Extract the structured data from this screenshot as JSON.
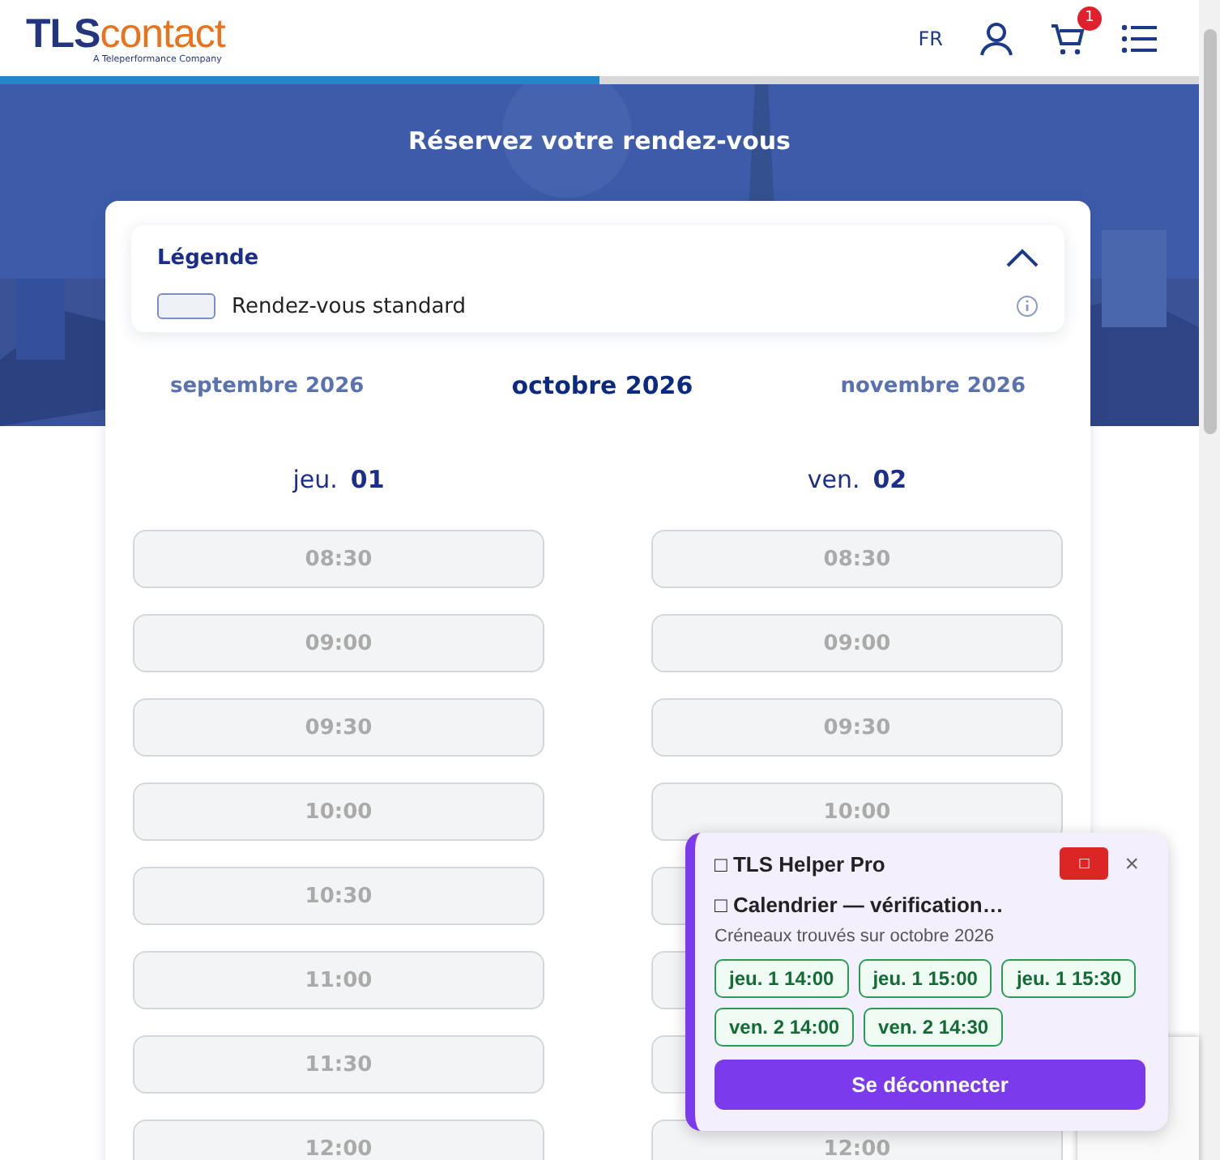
{
  "header": {
    "logo": {
      "brand_dark": "TLS",
      "brand_light": "contact",
      "tagline": "A Teleperformance Company"
    },
    "language": "FR",
    "cart_count": "1",
    "progress": {
      "level": 0.5
    }
  },
  "page_title": "Réservez votre rendez-vous",
  "legend": {
    "title": "Légende",
    "expanded": true,
    "items": [
      {
        "label": "Rendez-vous standard"
      }
    ]
  },
  "months": [
    {
      "label": "septembre 2026",
      "selected": false
    },
    {
      "label": "octobre 2026",
      "selected": true
    },
    {
      "label": "novembre 2026",
      "selected": false
    }
  ],
  "days": [
    {
      "weekday": "jeu.",
      "date": "01",
      "slots": [
        {
          "time": "08:30",
          "disabled": true
        },
        {
          "time": "09:00",
          "disabled": true
        },
        {
          "time": "09:30",
          "disabled": true
        },
        {
          "time": "10:00",
          "disabled": true
        },
        {
          "time": "10:30",
          "disabled": true
        },
        {
          "time": "11:00",
          "disabled": true
        },
        {
          "time": "11:30",
          "disabled": true
        },
        {
          "time": "12:00",
          "disabled": true
        }
      ]
    },
    {
      "weekday": "ven.",
      "date": "02",
      "slots": [
        {
          "time": "08:30",
          "disabled": true
        },
        {
          "time": "09:00",
          "disabled": true
        },
        {
          "time": "09:30",
          "disabled": true
        },
        {
          "time": "10:00",
          "disabled": true
        },
        {
          "disabled": true
        },
        {
          "disabled": true
        },
        {
          "disabled": true
        },
        {
          "time": "12:00",
          "disabled": true
        }
      ]
    }
  ],
  "helper_panel": {
    "title": "□ TLS Helper Pro",
    "stop_button": "□",
    "close": "×",
    "status": "□ Calendrier — vérification…",
    "subtitle": "Créneaux trouvés sur octobre 2026",
    "found_slots": [
      "jeu. 1 14:00",
      "jeu. 1 15:00",
      "jeu. 1 15:30",
      "ven. 2 14:00",
      "ven. 2 14:30"
    ],
    "logout_button": "Se déconnecter"
  }
}
